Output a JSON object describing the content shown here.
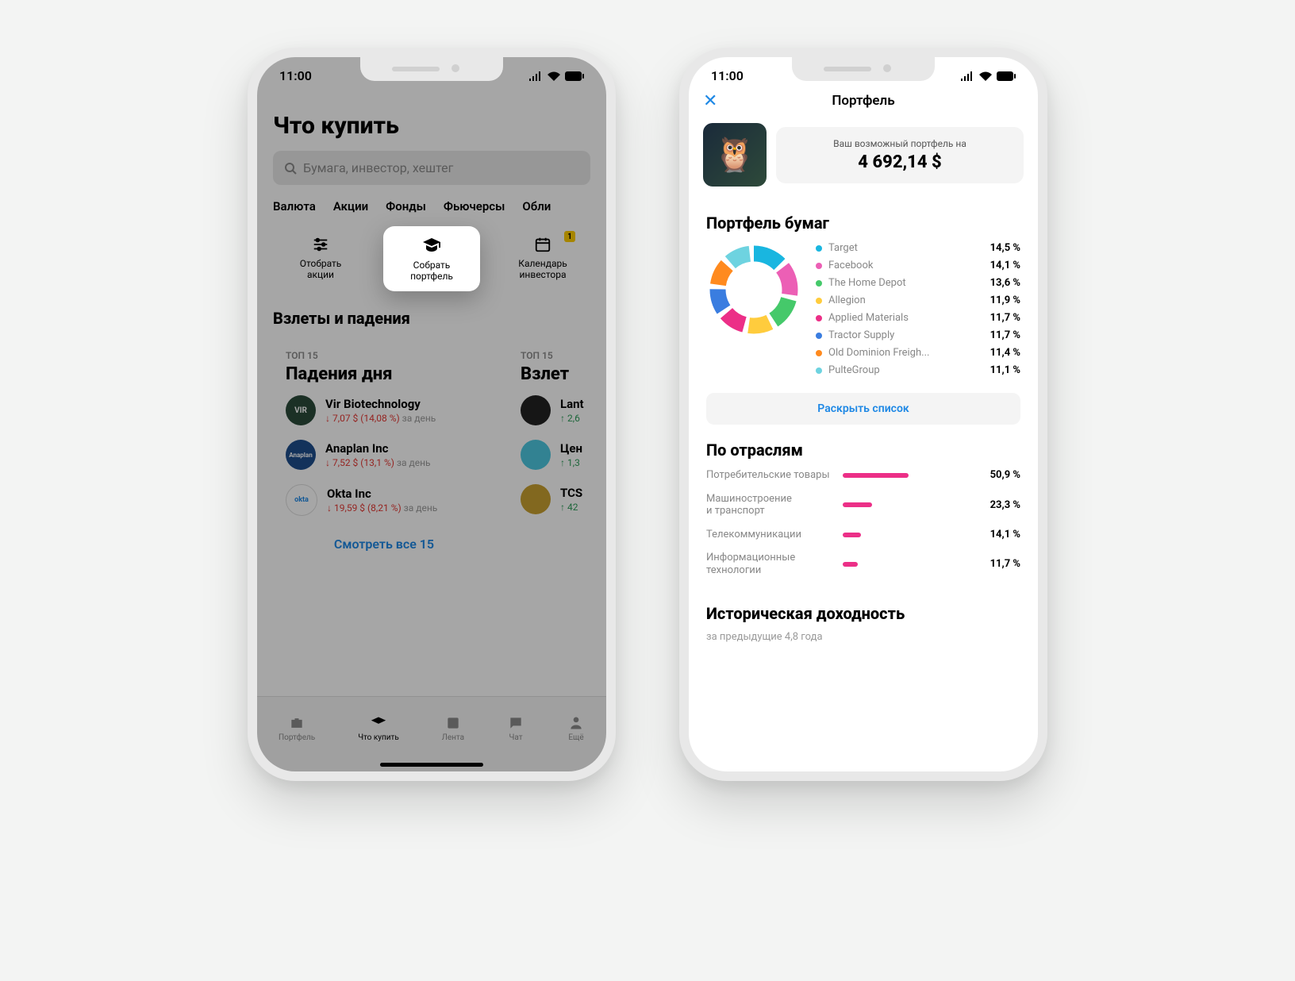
{
  "status_time": "11:00",
  "left": {
    "title": "Что купить",
    "search_placeholder": "Бумага, инвестор, хештег",
    "chips": [
      "Валюта",
      "Акции",
      "Фонды",
      "Фьючерсы",
      "Обли"
    ],
    "quick": [
      {
        "label": "Отобрать\nакции",
        "icon": "sliders"
      },
      {
        "label": "Собрать\nпортфель",
        "icon": "grad-cap",
        "highlight": true
      },
      {
        "label": "Календарь\nинвестора",
        "icon": "calendar",
        "badge": "1"
      }
    ],
    "section1": "Взлеты и падения",
    "cards": [
      {
        "top": "ТОП 15",
        "title": "Падения дня",
        "rows": [
          {
            "name": "Vir Biotechnology",
            "change": "↓ 7,07 $ (14,08 %)",
            "suffix": "за день",
            "avatar": "#2a4a3a",
            "txt": "VIR"
          },
          {
            "name": "Anaplan Inc",
            "change": "↓ 7,52 $ (13,1 %)",
            "suffix": "за день",
            "avatar": "#1e4d8c",
            "txt": "Anaplan"
          },
          {
            "name": "Okta Inc",
            "change": "↓ 19,59 $ (8,21 %)",
            "suffix": "за день",
            "avatar": "#1e88e5",
            "txt": "okta"
          }
        ],
        "link": "Смотреть все 15",
        "sign": "down"
      },
      {
        "top": "ТОП 15",
        "title": "Взлет",
        "rows": [
          {
            "name": "Lant",
            "change": "↑ 2,6",
            "avatar": "#222",
            "txt": "●"
          },
          {
            "name": "Цен",
            "change": "↑ 1,3",
            "avatar": "#4dc8e0",
            "txt": ""
          },
          {
            "name": "TCS",
            "change": "↑ 42",
            "avatar": "#c8a030",
            "txt": ""
          }
        ],
        "sign": "up"
      }
    ],
    "tabs": [
      "Портфель",
      "Что купить",
      "Лента",
      "Чат",
      "Ещё"
    ]
  },
  "right": {
    "header": "Портфель",
    "hero_label": "Ваш возможный портфель на",
    "hero_value": "4 692,14 $",
    "section_portfolio": "Портфель бумаг",
    "portfolio": [
      {
        "name": "Target",
        "value": "14,5 %",
        "color": "#19b6e0"
      },
      {
        "name": "Facebook",
        "value": "14,1 %",
        "color": "#ec5fb5"
      },
      {
        "name": "The Home Depot",
        "value": "13,6 %",
        "color": "#45c96a"
      },
      {
        "name": "Allegion",
        "value": "11,9 %",
        "color": "#ffcc3d"
      },
      {
        "name": "Applied Materials",
        "value": "11,7 %",
        "color": "#ec2f87"
      },
      {
        "name": "Tractor Supply",
        "value": "11,7 %",
        "color": "#3a7de0"
      },
      {
        "name": "Old Dominion Freigh...",
        "value": "11,4 %",
        "color": "#ff8a1e"
      },
      {
        "name": "PulteGroup",
        "value": "11,1 %",
        "color": "#6ed3e0"
      }
    ],
    "expand": "Раскрыть список",
    "section_industries": "По отраслям",
    "industries": [
      {
        "name": "Потребительские товары",
        "value": "50,9 %",
        "pct": 51
      },
      {
        "name": "Машиностроение\nи транспорт",
        "value": "23,3 %",
        "pct": 23
      },
      {
        "name": "Телекоммуникации",
        "value": "14,1 %",
        "pct": 14
      },
      {
        "name": "Информационные\nтехнологии",
        "value": "11,7 %",
        "pct": 12
      }
    ],
    "section_history": "Историческая доходность",
    "history_sub": "за предыдущие 4,8 года"
  },
  "chart_data": [
    {
      "type": "pie",
      "title": "Портфель бумаг",
      "series": [
        {
          "name": "Target",
          "value": 14.5
        },
        {
          "name": "Facebook",
          "value": 14.1
        },
        {
          "name": "The Home Depot",
          "value": 13.6
        },
        {
          "name": "Allegion",
          "value": 11.9
        },
        {
          "name": "Applied Materials",
          "value": 11.7
        },
        {
          "name": "Tractor Supply",
          "value": 11.7
        },
        {
          "name": "Old Dominion Freight",
          "value": 11.4
        },
        {
          "name": "PulteGroup",
          "value": 11.1
        }
      ]
    },
    {
      "type": "bar",
      "title": "По отраслям",
      "categories": [
        "Потребительские товары",
        "Машиностроение и транспорт",
        "Телекоммуникации",
        "Информационные технологии"
      ],
      "values": [
        50.9,
        23.3,
        14.1,
        11.7
      ]
    }
  ]
}
